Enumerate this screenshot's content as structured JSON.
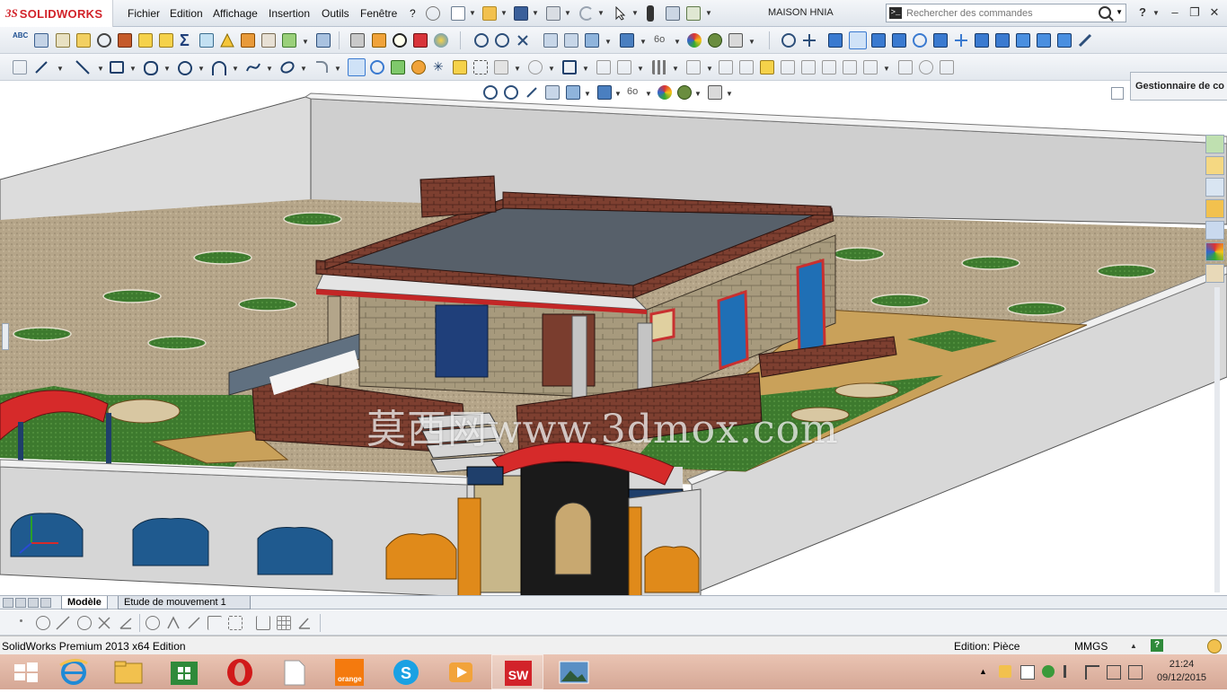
{
  "app": {
    "brand_ds": "3S",
    "brand_name": "SOLIDWORKS",
    "document_title": "MAISON HNIA",
    "brand_color": "#d2232a"
  },
  "menu": {
    "items": [
      "Fichier",
      "Edition",
      "Affichage",
      "Insertion",
      "Outils",
      "Fenêtre",
      "?"
    ]
  },
  "search": {
    "placeholder": "Rechercher des commandes",
    "help_label": "?"
  },
  "toolbar1": {
    "icons": [
      "spelling-icon",
      "find-icon",
      "measure-icon",
      "mass-properties-icon",
      "section-icon",
      "check-icon",
      "check2-icon",
      "sum-icon",
      "equations-icon",
      "warning-icon",
      "split-icon",
      "hole-icon",
      "rebuild-icon",
      "zoom-fit-icon",
      "zoom-area-icon",
      "rotate-icon",
      "view-orient-icon",
      "display-style-icon",
      "hide-show-icon",
      "appearance-icon",
      "scene-icon",
      "render-icon"
    ],
    "spell_label": "ABC"
  },
  "toolbar2": {
    "icons": [
      "smart-dimension-icon",
      "line-icon",
      "rectangle-icon",
      "slot-icon",
      "circle-icon",
      "arc-icon",
      "spline-icon",
      "ellipse-icon",
      "fillet-icon",
      "rotate-view-icon",
      "refresh-icon",
      "convert-icon",
      "point-icon",
      "offset-icon",
      "mirror-icon",
      "trim-icon",
      "pattern-icon",
      "move-icon"
    ]
  },
  "feature_manager": {
    "tab_label": "Gestionnaire de co"
  },
  "watermark": {
    "text": "莫西网www.3dmox.com"
  },
  "model_tabs": {
    "items": [
      "Modèle",
      "Etude de mouvement 1"
    ],
    "active": 0
  },
  "statusbar": {
    "product": "SolidWorks Premium 2013 x64 Edition",
    "mode": "Edition: Pièce",
    "units": "MMGS",
    "help": "?"
  },
  "taskbar": {
    "apps": [
      "windows-start",
      "internet-explorer",
      "file-explorer",
      "store",
      "opera",
      "document",
      "orange",
      "skype",
      "media-player",
      "solidworks",
      "photos"
    ],
    "orange_label": "orange",
    "time": "21:24",
    "date": "09/12/2015"
  },
  "scene_colors": {
    "sky": "#ffffff",
    "wall": "#d8d8d8",
    "sand": "#b8a68a",
    "grass": "#3f7a2e",
    "roof": "#5a6268",
    "brick": "#7a3d2e",
    "awning": "#d62a2a",
    "stone": "#a89a78",
    "door_blue": "#1f6fb5"
  }
}
